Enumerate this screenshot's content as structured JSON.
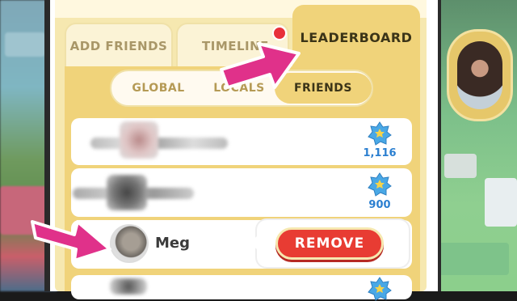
{
  "tabs": [
    {
      "label": "ADD FRIENDS"
    },
    {
      "label": "TIMELINE"
    },
    {
      "label": "LEADERBOARD"
    }
  ],
  "segments": [
    {
      "label": "GLOBAL"
    },
    {
      "label": "LOCALS"
    },
    {
      "label": "FRIENDS"
    }
  ],
  "rows": [
    {
      "score": "1,116"
    },
    {
      "score": "900"
    },
    {
      "name": "Meg",
      "action": "REMOVE"
    }
  ],
  "colors": {
    "accent": "#f0d37a",
    "remove": "#e83c33",
    "arrow": "#e0318a",
    "score": "#2b7fd0"
  }
}
